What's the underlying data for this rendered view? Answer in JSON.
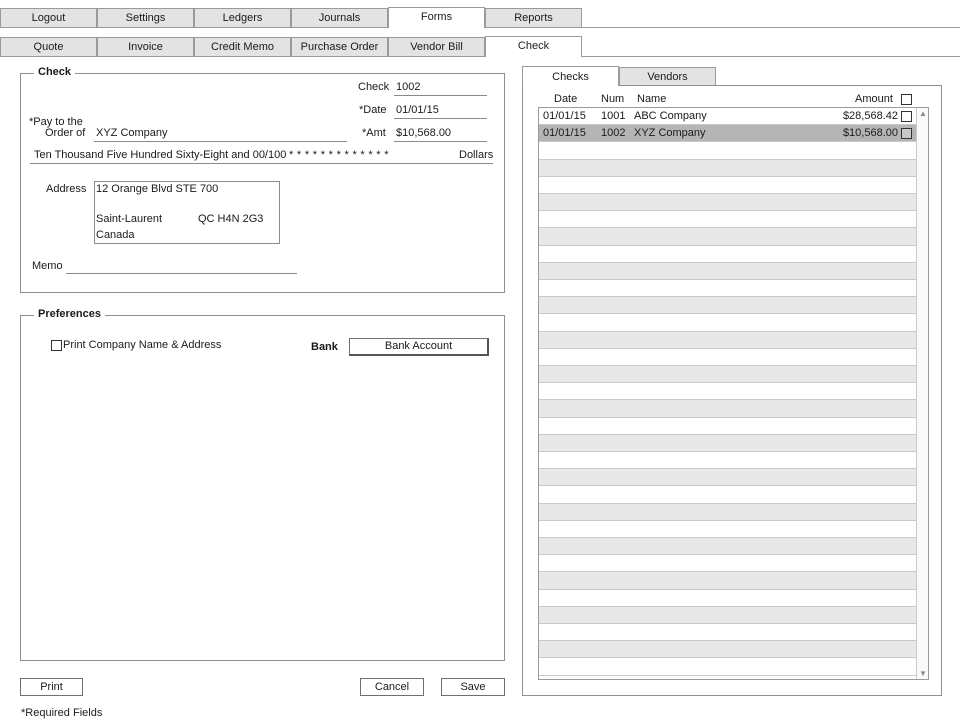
{
  "main_tabs": [
    "Logout",
    "Settings",
    "Ledgers",
    "Journals",
    "Forms",
    "Reports"
  ],
  "form_tabs": [
    "Quote",
    "Invoice",
    "Credit Memo",
    "Purchase Order",
    "Vendor Bill",
    "Check"
  ],
  "check": {
    "legend": "Check",
    "number_label": "Check",
    "number": "1002",
    "date_label": "*Date",
    "date": "01/01/15",
    "payto_label_1": "*Pay to the",
    "payto_label_2": "Order of",
    "payee": "XYZ Company",
    "amt_label": "*Amt",
    "amount": "$10,568.00",
    "amount_words": "Ten Thousand Five Hundred Sixty-Eight and 00/100",
    "stars": "* * * * * * * * * * * * *",
    "dollars_label": "Dollars",
    "address_label": "Address",
    "address_line1": "12 Orange Blvd STE 700",
    "address_city": "Saint-Laurent",
    "address_region": "QC  H4N 2G3",
    "address_country": "Canada",
    "memo_label": "Memo",
    "memo": ""
  },
  "preferences": {
    "legend": "Preferences",
    "print_company_label": "Print Company Name & Address",
    "print_company_checked": false,
    "bank_label": "Bank",
    "bank_account_button": "Bank Account"
  },
  "buttons": {
    "print": "Print",
    "cancel": "Cancel",
    "save": "Save"
  },
  "required_note": "*Required Fields",
  "right_panel": {
    "tabs": [
      "Checks",
      "Vendors"
    ],
    "columns": [
      "Date",
      "Num",
      "Name",
      "Amount"
    ],
    "rows": [
      {
        "date": "01/01/15",
        "num": "1001",
        "name": "ABC Company",
        "amount": "$28,568.42",
        "selected": false
      },
      {
        "date": "01/01/15",
        "num": "1002",
        "name": "XYZ Company",
        "amount": "$10,568.00",
        "selected": true
      }
    ]
  },
  "colors": {
    "tab_bg": "#e3e3e3",
    "row_alt": "#e8e8e8",
    "row_selected": "#b5b5b5",
    "border": "#8f8f8f"
  }
}
